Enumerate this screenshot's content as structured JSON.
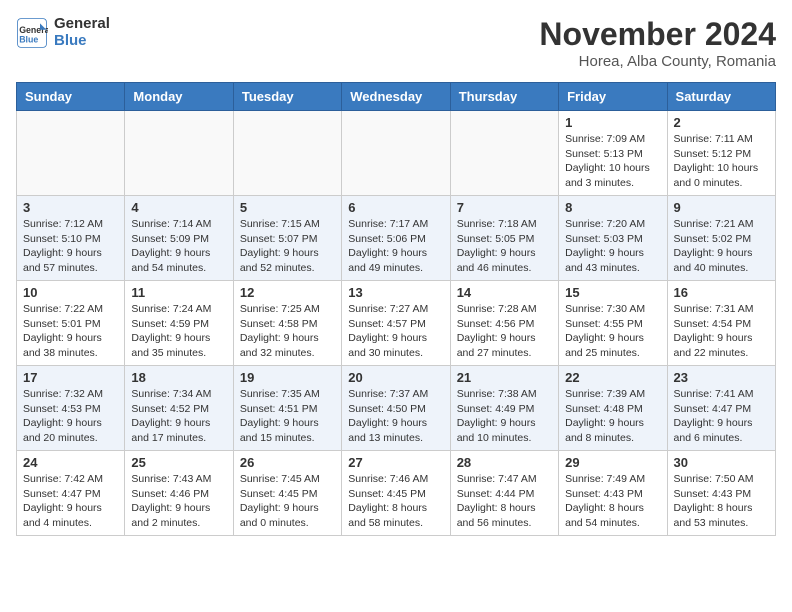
{
  "header": {
    "logo_line1": "General",
    "logo_line2": "Blue",
    "month_title": "November 2024",
    "location": "Horea, Alba County, Romania"
  },
  "weekdays": [
    "Sunday",
    "Monday",
    "Tuesday",
    "Wednesday",
    "Thursday",
    "Friday",
    "Saturday"
  ],
  "weeks": [
    [
      {
        "day": "",
        "info": ""
      },
      {
        "day": "",
        "info": ""
      },
      {
        "day": "",
        "info": ""
      },
      {
        "day": "",
        "info": ""
      },
      {
        "day": "",
        "info": ""
      },
      {
        "day": "1",
        "info": "Sunrise: 7:09 AM\nSunset: 5:13 PM\nDaylight: 10 hours\nand 3 minutes."
      },
      {
        "day": "2",
        "info": "Sunrise: 7:11 AM\nSunset: 5:12 PM\nDaylight: 10 hours\nand 0 minutes."
      }
    ],
    [
      {
        "day": "3",
        "info": "Sunrise: 7:12 AM\nSunset: 5:10 PM\nDaylight: 9 hours\nand 57 minutes."
      },
      {
        "day": "4",
        "info": "Sunrise: 7:14 AM\nSunset: 5:09 PM\nDaylight: 9 hours\nand 54 minutes."
      },
      {
        "day": "5",
        "info": "Sunrise: 7:15 AM\nSunset: 5:07 PM\nDaylight: 9 hours\nand 52 minutes."
      },
      {
        "day": "6",
        "info": "Sunrise: 7:17 AM\nSunset: 5:06 PM\nDaylight: 9 hours\nand 49 minutes."
      },
      {
        "day": "7",
        "info": "Sunrise: 7:18 AM\nSunset: 5:05 PM\nDaylight: 9 hours\nand 46 minutes."
      },
      {
        "day": "8",
        "info": "Sunrise: 7:20 AM\nSunset: 5:03 PM\nDaylight: 9 hours\nand 43 minutes."
      },
      {
        "day": "9",
        "info": "Sunrise: 7:21 AM\nSunset: 5:02 PM\nDaylight: 9 hours\nand 40 minutes."
      }
    ],
    [
      {
        "day": "10",
        "info": "Sunrise: 7:22 AM\nSunset: 5:01 PM\nDaylight: 9 hours\nand 38 minutes."
      },
      {
        "day": "11",
        "info": "Sunrise: 7:24 AM\nSunset: 4:59 PM\nDaylight: 9 hours\nand 35 minutes."
      },
      {
        "day": "12",
        "info": "Sunrise: 7:25 AM\nSunset: 4:58 PM\nDaylight: 9 hours\nand 32 minutes."
      },
      {
        "day": "13",
        "info": "Sunrise: 7:27 AM\nSunset: 4:57 PM\nDaylight: 9 hours\nand 30 minutes."
      },
      {
        "day": "14",
        "info": "Sunrise: 7:28 AM\nSunset: 4:56 PM\nDaylight: 9 hours\nand 27 minutes."
      },
      {
        "day": "15",
        "info": "Sunrise: 7:30 AM\nSunset: 4:55 PM\nDaylight: 9 hours\nand 25 minutes."
      },
      {
        "day": "16",
        "info": "Sunrise: 7:31 AM\nSunset: 4:54 PM\nDaylight: 9 hours\nand 22 minutes."
      }
    ],
    [
      {
        "day": "17",
        "info": "Sunrise: 7:32 AM\nSunset: 4:53 PM\nDaylight: 9 hours\nand 20 minutes."
      },
      {
        "day": "18",
        "info": "Sunrise: 7:34 AM\nSunset: 4:52 PM\nDaylight: 9 hours\nand 17 minutes."
      },
      {
        "day": "19",
        "info": "Sunrise: 7:35 AM\nSunset: 4:51 PM\nDaylight: 9 hours\nand 15 minutes."
      },
      {
        "day": "20",
        "info": "Sunrise: 7:37 AM\nSunset: 4:50 PM\nDaylight: 9 hours\nand 13 minutes."
      },
      {
        "day": "21",
        "info": "Sunrise: 7:38 AM\nSunset: 4:49 PM\nDaylight: 9 hours\nand 10 minutes."
      },
      {
        "day": "22",
        "info": "Sunrise: 7:39 AM\nSunset: 4:48 PM\nDaylight: 9 hours\nand 8 minutes."
      },
      {
        "day": "23",
        "info": "Sunrise: 7:41 AM\nSunset: 4:47 PM\nDaylight: 9 hours\nand 6 minutes."
      }
    ],
    [
      {
        "day": "24",
        "info": "Sunrise: 7:42 AM\nSunset: 4:47 PM\nDaylight: 9 hours\nand 4 minutes."
      },
      {
        "day": "25",
        "info": "Sunrise: 7:43 AM\nSunset: 4:46 PM\nDaylight: 9 hours\nand 2 minutes."
      },
      {
        "day": "26",
        "info": "Sunrise: 7:45 AM\nSunset: 4:45 PM\nDaylight: 9 hours\nand 0 minutes."
      },
      {
        "day": "27",
        "info": "Sunrise: 7:46 AM\nSunset: 4:45 PM\nDaylight: 8 hours\nand 58 minutes."
      },
      {
        "day": "28",
        "info": "Sunrise: 7:47 AM\nSunset: 4:44 PM\nDaylight: 8 hours\nand 56 minutes."
      },
      {
        "day": "29",
        "info": "Sunrise: 7:49 AM\nSunset: 4:43 PM\nDaylight: 8 hours\nand 54 minutes."
      },
      {
        "day": "30",
        "info": "Sunrise: 7:50 AM\nSunset: 4:43 PM\nDaylight: 8 hours\nand 53 minutes."
      }
    ]
  ]
}
